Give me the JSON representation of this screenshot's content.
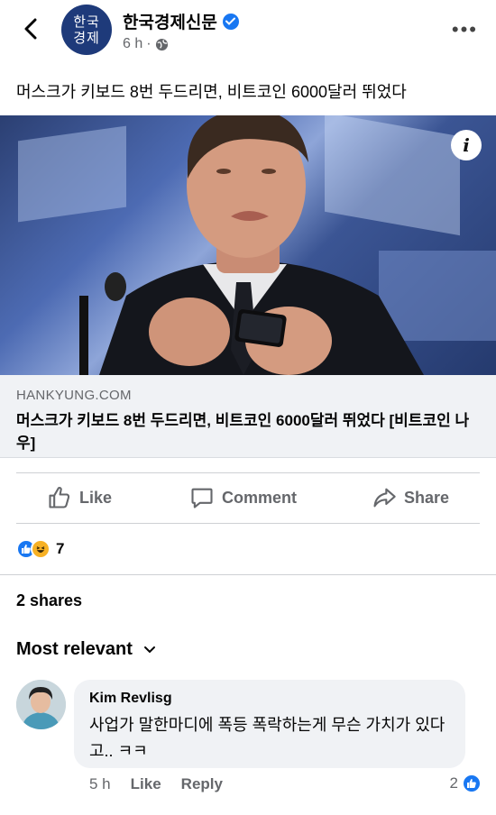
{
  "header": {
    "logo_line1": "한국",
    "logo_line2": "경제",
    "page_name": "한국경제신문",
    "time": "6 h",
    "separator": "·",
    "more": "•••"
  },
  "post": {
    "text": "머스크가 키보드 8번 두드리면, 비트코인 6000달러 뛰었다"
  },
  "image": {
    "info": "i"
  },
  "link": {
    "domain": "HANKYUNG.COM",
    "title": "머스크가 키보드 8번 두드리면, 비트코인 6000달러 뛰었다 [비트코인 나우]"
  },
  "actions": {
    "like": "Like",
    "comment": "Comment",
    "share": "Share"
  },
  "reactions": {
    "count": "7"
  },
  "shares": "2 shares",
  "comments": {
    "sort_label": "Most relevant",
    "items": [
      {
        "author": "Kim Revlisg",
        "text": "사업가 말한마디에 폭등 폭락하는게 무슨 가치가 있다고.. ㅋㅋ",
        "time": "5 h",
        "like": "Like",
        "reply": "Reply",
        "reaction_count": "2"
      }
    ]
  },
  "colors": {
    "brand_blue": "#1877f2",
    "logo_navy": "#1e3a7a",
    "secondary_text": "#65676b"
  }
}
